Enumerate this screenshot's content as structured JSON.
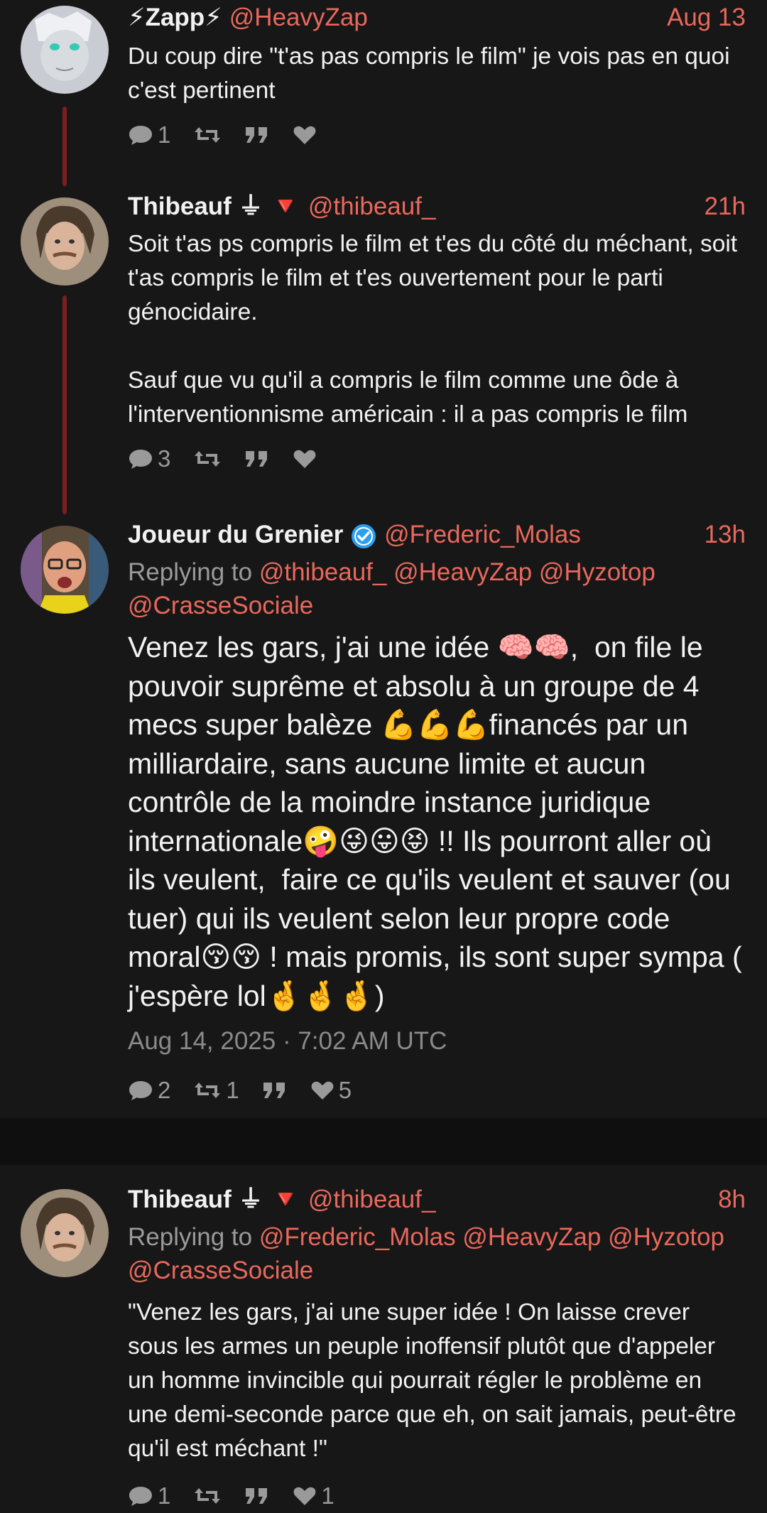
{
  "tweets": [
    {
      "name": "⚡Zapp⚡",
      "handle": "@HeavyZap",
      "time": "Aug 13",
      "body": "Du coup dire \"t'as pas compris le film\" je vois pas en quoi c'est pertinent",
      "replies": "1",
      "retweets": "",
      "likes": ""
    },
    {
      "name": "Thibeauf ⏚ 🔻",
      "handle": "@thibeauf_",
      "time": "21h",
      "body": "Soit t'as ps compris le film et t'es du côté du méchant, soit t'as compris le film et t'es ouvertement pour le parti génocidaire.\n\nSauf que vu qu'il a compris le film comme une ôde à l'interventionnisme américain : il a pas compris le film",
      "replies": "3",
      "retweets": "",
      "likes": ""
    },
    {
      "name": "Joueur du Grenier",
      "handle": "@Frederic_Molas",
      "time": "13h",
      "replying_label": "Replying to",
      "mentions": [
        "@thibeauf_",
        "@HeavyZap",
        "@Hyzotop",
        "@CrasseSociale"
      ],
      "body": "Venez les gars, j'ai une idée 🧠🧠,  on file le pouvoir suprême et absolu à un groupe de 4 mecs super balèze 💪💪💪financés par un milliardaire, sans aucune limite et aucun contrôle de la moindre instance juridique internationale🤪😜😛😝 !! Ils pourront aller où ils veulent,  faire ce qu'ils veulent et sauver (ou tuer) qui ils veulent selon leur propre code moral😚😚 ! mais promis, ils sont super sympa ( j'espère lol🤞🤞🤞)",
      "timestamp": "Aug 14, 2025 · 7:02 AM UTC",
      "replies": "2",
      "retweets": "1",
      "likes": "5"
    },
    {
      "name": "Thibeauf ⏚ 🔻",
      "handle": "@thibeauf_",
      "time": "8h",
      "replying_label": "Replying to",
      "mentions": [
        "@Frederic_Molas",
        "@HeavyZap",
        "@Hyzotop",
        "@CrasseSociale"
      ],
      "body": "\"Venez les gars, j'ai une super idée ! On laisse crever sous les armes un peuple inoffensif plutôt que d'appeler un homme invincible qui pourrait régler le problème en une demi-seconde parce que eh, on sait jamais, peut-être qu'il est méchant !\"",
      "replies": "1",
      "retweets": "",
      "likes": "1"
    }
  ],
  "colors": {
    "accent": "#e9685c",
    "background": "#171717",
    "muted": "#9a9a9a",
    "thread_line": "#7a1f1f"
  }
}
